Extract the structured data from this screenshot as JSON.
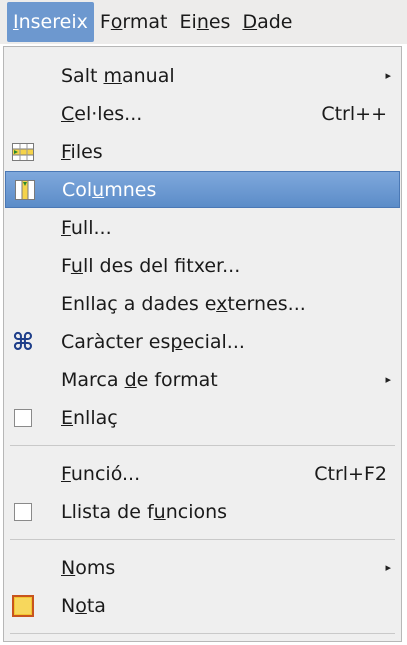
{
  "menubar": {
    "items": [
      {
        "pre": "",
        "u": "I",
        "post": "nsereix"
      },
      {
        "pre": "F",
        "u": "o",
        "post": "rmat"
      },
      {
        "pre": "Ei",
        "u": "n",
        "post": "es"
      },
      {
        "pre": "",
        "u": "D",
        "post": "ade"
      }
    ]
  },
  "menu": {
    "items": [
      {
        "pre": "Salt ",
        "u": "m",
        "post": "anual",
        "shortcut": "",
        "submenu": "▸"
      },
      {
        "pre": "",
        "u": "C",
        "post": "el·les...",
        "shortcut": "Ctrl++"
      },
      {
        "pre": "",
        "u": "F",
        "post": "iles",
        "icon": "insert-rows-icon"
      },
      {
        "pre": "Col",
        "u": "u",
        "post": "mnes",
        "icon": "insert-columns-icon"
      },
      {
        "pre": "",
        "u": "F",
        "post": "ull..."
      },
      {
        "pre": "F",
        "u": "u",
        "post": "ll des del fitxer..."
      },
      {
        "pre": "Enllaç a dades e",
        "u": "x",
        "post": "ternes..."
      },
      {
        "pre": "Caràcter es",
        "u": "p",
        "post": "ecial...",
        "icon": "special-character-icon",
        "icon_glyph": "⌘"
      },
      {
        "pre": "Marca ",
        "u": "d",
        "post": "e format",
        "submenu": "▸"
      },
      {
        "pre": "",
        "u": "E",
        "post": "nllaç",
        "icon": "hyperlink-checkbox-icon"
      },
      {
        "pre": "",
        "u": "F",
        "post": "unció...",
        "shortcut": "Ctrl+F2"
      },
      {
        "pre": "Llista de f",
        "u": "u",
        "post": "ncions",
        "icon": "function-list-checkbox-icon"
      },
      {
        "pre": "",
        "u": "N",
        "post": "oms",
        "submenu": "▸"
      },
      {
        "pre": "N",
        "u": "o",
        "post": "ta",
        "icon": "note-icon"
      }
    ]
  },
  "colors": {
    "highlight": "#6a97d1",
    "menubar_bg": "#edeceb",
    "menu_bg": "#efefef"
  }
}
